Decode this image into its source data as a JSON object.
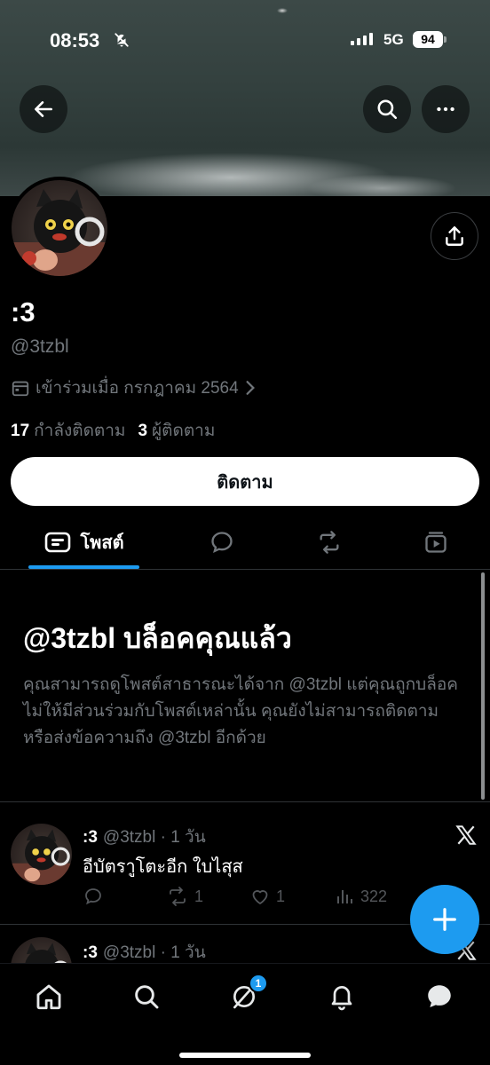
{
  "status_bar": {
    "time": "08:53",
    "network": "5G",
    "battery": "94"
  },
  "profile": {
    "display_name": ":3",
    "handle": "@3tzbl",
    "joined": "เข้าร่วมเมื่อ กรกฎาคม 2564",
    "following_count": "17",
    "following_label": "กำลังติดตาม",
    "followers_count": "3",
    "followers_label": "ผู้ติดตาม",
    "follow_button": "ติดตาม"
  },
  "tabs": {
    "posts": "โพสต์"
  },
  "blocked_notice": {
    "title": "@3tzbl บล็อคคุณแล้ว",
    "body": "คุณสามารถดูโพสต์สาธารณะได้จาก @3tzbl แต่คุณถูกบล็อคไม่ให้มีส่วนร่วมกับโพสต์เหล่านั้น คุณยังไม่สามารถติดตามหรือส่งข้อความถึง @3tzbl อีกด้วย"
  },
  "posts": [
    {
      "name": ":3",
      "meta": "@3tzbl · 1 วัน",
      "text": "อีบัตราูโตะอีก ใบไสุส",
      "replies": "",
      "reposts": "1",
      "likes": "1",
      "views": "322"
    },
    {
      "name": ":3",
      "meta": "@3tzbl · 1 วัน"
    }
  ],
  "bottom_nav": {
    "notifications_badge": "1"
  },
  "colors": {
    "accent": "#1d9bf0",
    "background": "#000000",
    "muted_text": "#71767b"
  }
}
